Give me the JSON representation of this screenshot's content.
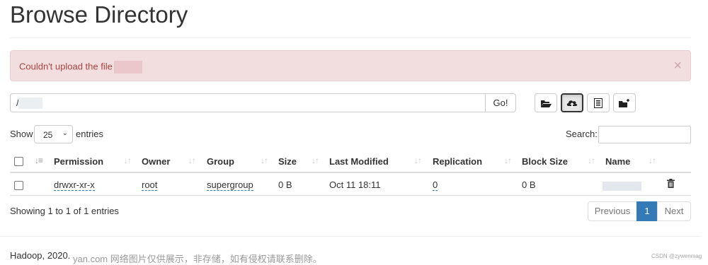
{
  "page": {
    "title": "Browse Directory"
  },
  "alert": {
    "message": "Couldn't upload the file",
    "close_glyph": "×"
  },
  "path_bar": {
    "value": "/",
    "go_label": "Go!"
  },
  "toolbar": {
    "buttons": [
      {
        "icon": "folder-open-icon",
        "glyph": "📂"
      },
      {
        "icon": "upload-cloud-icon",
        "glyph": "⬆"
      },
      {
        "icon": "list-icon",
        "glyph": "▤"
      },
      {
        "icon": "new-folder-icon",
        "glyph": "📁"
      }
    ]
  },
  "table_controls": {
    "show_label": "Show",
    "length_value": "25",
    "entries_label": "entries",
    "search_label": "Search:",
    "search_value": ""
  },
  "table": {
    "columns": [
      "Permission",
      "Owner",
      "Group",
      "Size",
      "Last Modified",
      "Replication",
      "Block Size",
      "Name"
    ],
    "rows": [
      {
        "permission": "drwxr-xr-x",
        "owner": "root",
        "group": "supergroup",
        "size": "0 B",
        "last_modified": "Oct 11 18:11",
        "replication": "0",
        "block_size": "0 B",
        "name": ""
      }
    ]
  },
  "info": {
    "showing": "Showing 1 to 1 of 1 entries"
  },
  "pagination": {
    "previous": "Previous",
    "current": "1",
    "next": "Next"
  },
  "footer": {
    "text": "Hadoop, 2020."
  },
  "watermark": {
    "text": "yan.com 网络图片仅供展示，非存储，如有侵权请联系删除。",
    "corner": "CSDN @zywenmag"
  },
  "colors": {
    "alert_bg": "#f2dede",
    "alert_text": "#a94442",
    "primary": "#337ab7"
  }
}
